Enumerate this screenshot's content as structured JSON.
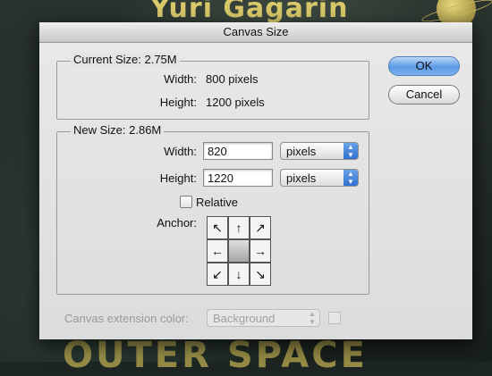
{
  "background": {
    "poster_title": "Yuri Gagarin",
    "poster_bottom": "OUTER SPACE"
  },
  "dialog": {
    "title": "Canvas Size",
    "current_size": {
      "label": "Current Size: 2.75M",
      "width_label": "Width:",
      "width_value": "800 pixels",
      "height_label": "Height:",
      "height_value": "1200 pixels"
    },
    "new_size": {
      "label": "New Size: 2.86M",
      "width_label": "Width:",
      "width_value": "820",
      "width_unit": "pixels",
      "height_label": "Height:",
      "height_value": "1220",
      "height_unit": "pixels",
      "relative_label": "Relative",
      "relative_checked": false,
      "anchor_label": "Anchor:",
      "anchor_arrows": [
        "↖",
        "↑",
        "↗",
        "←",
        "",
        "→",
        "↙",
        "↓",
        "↘"
      ]
    },
    "extension": {
      "label": "Canvas extension color:",
      "value": "Background"
    },
    "buttons": {
      "ok": "OK",
      "cancel": "Cancel"
    }
  }
}
